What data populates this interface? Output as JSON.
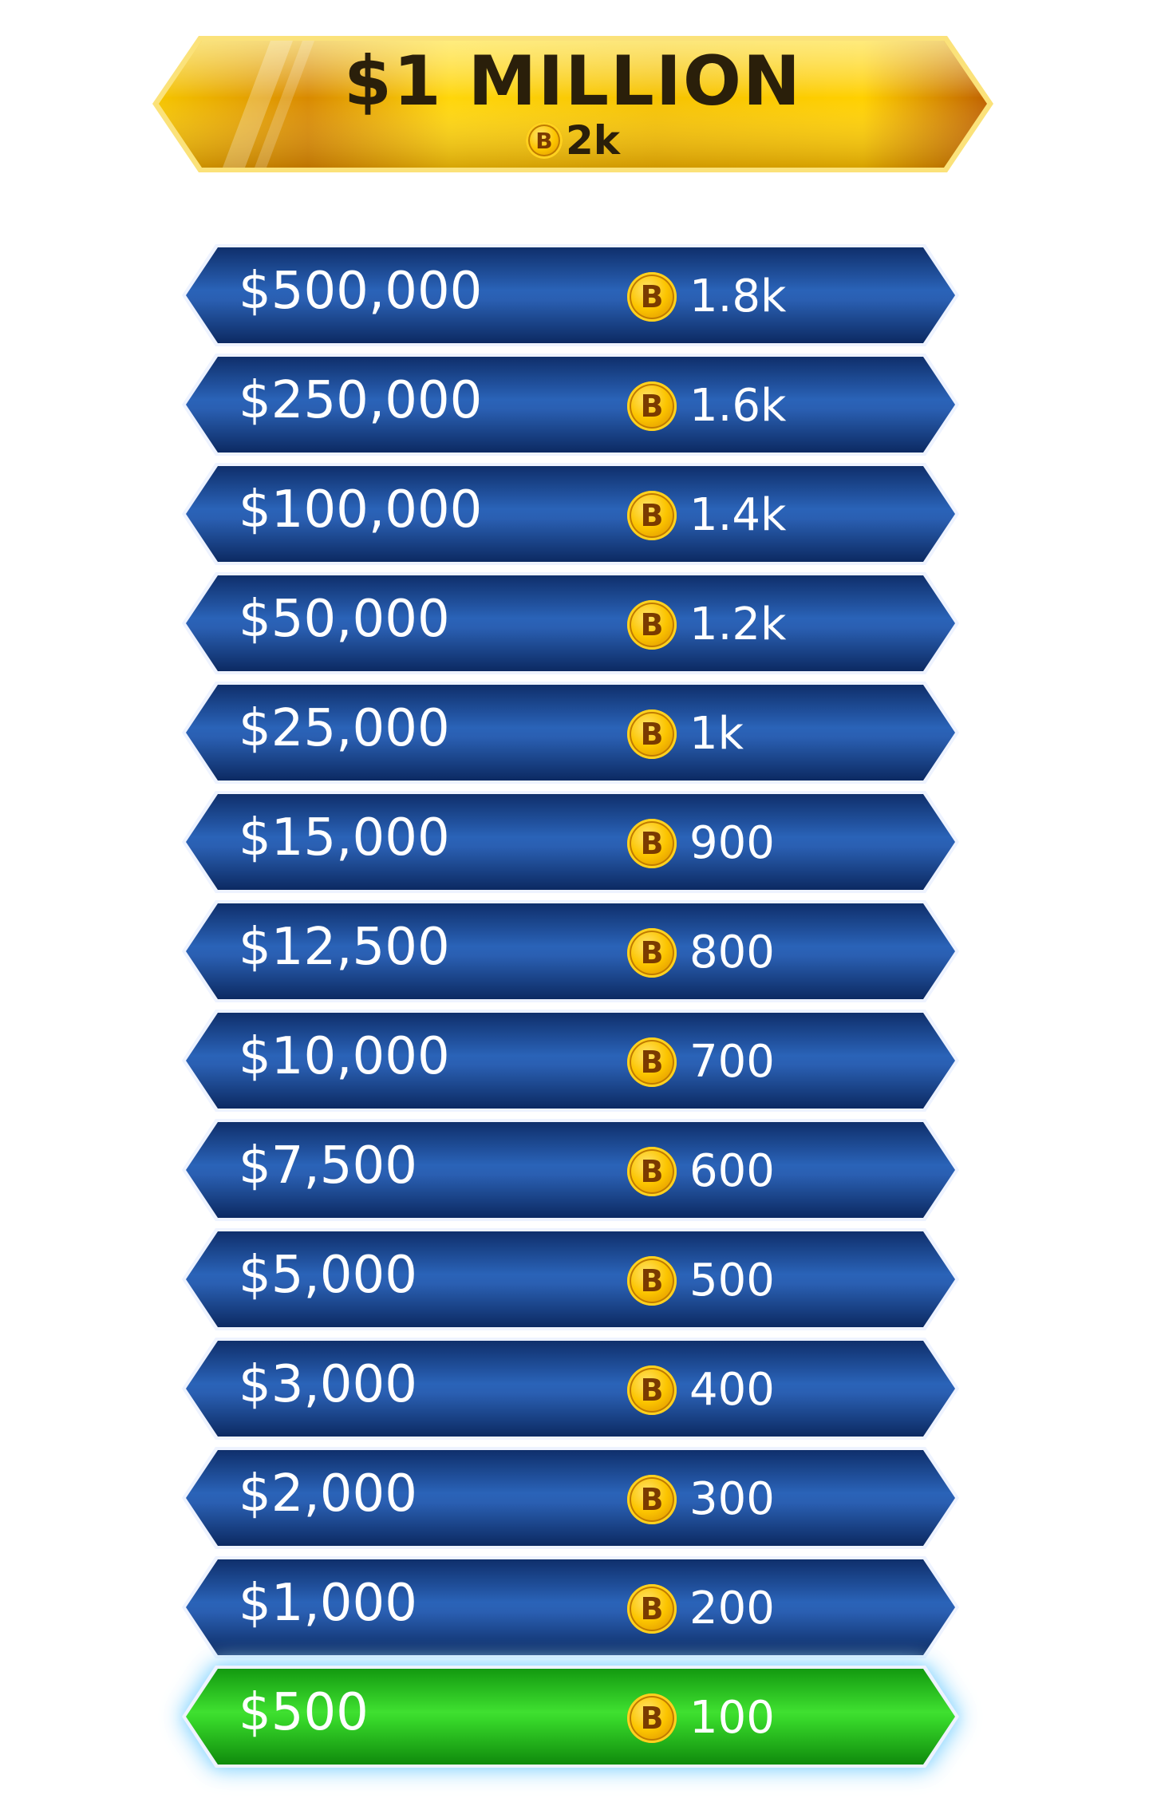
{
  "top_prize": {
    "amount": "$1 MILLION",
    "coin_icon": "coin-icon",
    "coin_letter": "B",
    "coins": "2k"
  },
  "coin_letter": "B",
  "colors": {
    "rung_blue": "#1a4a94",
    "rung_current_green": "#22c21a",
    "gold": "#f2b705"
  },
  "ladder": [
    {
      "amount": "$500,000",
      "coins": "1.8k",
      "current": false
    },
    {
      "amount": "$250,000",
      "coins": "1.6k",
      "current": false
    },
    {
      "amount": "$100,000",
      "coins": "1.4k",
      "current": false
    },
    {
      "amount": "$50,000",
      "coins": "1.2k",
      "current": false
    },
    {
      "amount": "$25,000",
      "coins": "1k",
      "current": false
    },
    {
      "amount": "$15,000",
      "coins": "900",
      "current": false
    },
    {
      "amount": "$12,500",
      "coins": "800",
      "current": false
    },
    {
      "amount": "$10,000",
      "coins": "700",
      "current": false
    },
    {
      "amount": "$7,500",
      "coins": "600",
      "current": false
    },
    {
      "amount": "$5,000",
      "coins": "500",
      "current": false
    },
    {
      "amount": "$3,000",
      "coins": "400",
      "current": false
    },
    {
      "amount": "$2,000",
      "coins": "300",
      "current": false
    },
    {
      "amount": "$1,000",
      "coins": "200",
      "current": false
    },
    {
      "amount": "$500",
      "coins": "100",
      "current": true
    }
  ]
}
